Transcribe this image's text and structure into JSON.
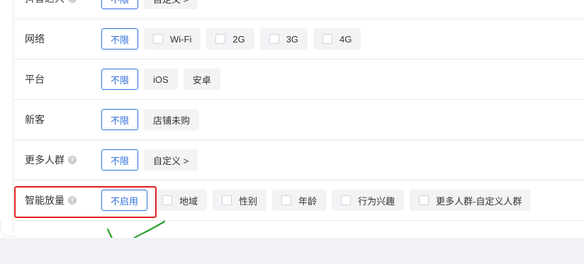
{
  "rows": [
    {
      "label": "抖音达人",
      "has_help": true,
      "options": [
        {
          "label": "不限",
          "active": true,
          "checkbox": false
        },
        {
          "label": "自定义 >",
          "active": false,
          "checkbox": false
        }
      ]
    },
    {
      "label": "网络",
      "has_help": false,
      "options": [
        {
          "label": "不限",
          "active": true,
          "checkbox": false
        },
        {
          "label": "Wi-Fi",
          "active": false,
          "checkbox": true
        },
        {
          "label": "2G",
          "active": false,
          "checkbox": true
        },
        {
          "label": "3G",
          "active": false,
          "checkbox": true
        },
        {
          "label": "4G",
          "active": false,
          "checkbox": true
        }
      ]
    },
    {
      "label": "平台",
      "has_help": false,
      "options": [
        {
          "label": "不限",
          "active": true,
          "checkbox": false
        },
        {
          "label": "iOS",
          "active": false,
          "checkbox": false
        },
        {
          "label": "安卓",
          "active": false,
          "checkbox": false
        }
      ]
    },
    {
      "label": "新客",
      "has_help": false,
      "options": [
        {
          "label": "不限",
          "active": true,
          "checkbox": false
        },
        {
          "label": "店铺未购",
          "active": false,
          "checkbox": false
        }
      ]
    },
    {
      "label": "更多人群",
      "has_help": true,
      "options": [
        {
          "label": "不限",
          "active": true,
          "checkbox": false
        },
        {
          "label": "自定义 >",
          "active": false,
          "checkbox": false
        }
      ]
    },
    {
      "label": "智能放量",
      "has_help": true,
      "options": [
        {
          "label": "不启用",
          "active": true,
          "checkbox": false
        },
        {
          "label": "地域",
          "active": false,
          "checkbox": true
        },
        {
          "label": "性别",
          "active": false,
          "checkbox": true
        },
        {
          "label": "年龄",
          "active": false,
          "checkbox": true
        },
        {
          "label": "行为兴趣",
          "active": false,
          "checkbox": true
        },
        {
          "label": "更多人群-自定义人群",
          "active": false,
          "checkbox": true
        }
      ]
    }
  ],
  "help_glyph": "?",
  "colors": {
    "accent": "#2f6fdc",
    "annotation_box": "#e02020",
    "annotation_check": "#2aa12a"
  }
}
